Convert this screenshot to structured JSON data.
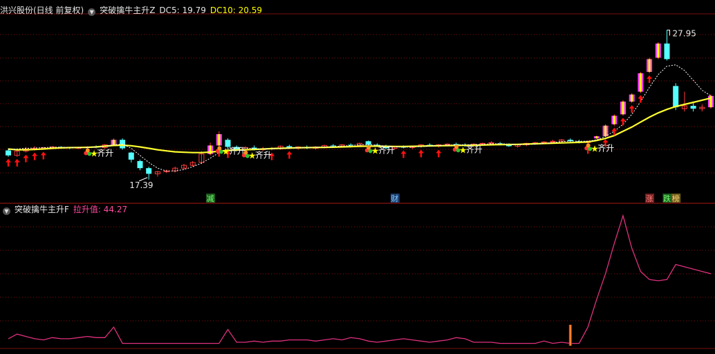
{
  "upper_panel": {
    "stock": "洪兴股份(日线 前复权)",
    "indicator": "突破擒牛主升Z",
    "dc5_label": "DC5: 19.79",
    "dc10_label": "DC10: 20.59",
    "high_label": "27.95",
    "low_label": "17.39",
    "signal_label": "齐升",
    "badges": {
      "jian": "减",
      "cai": "财",
      "zhang": "涨",
      "die": "跌",
      "bang": "榜"
    }
  },
  "lower_panel": {
    "indicator": "突破擒牛主升F",
    "value_label": "拉升值: 44.27"
  },
  "colors": {
    "up": "#ff3a3a",
    "down": "#54ffff",
    "magenta": "#ff3cff",
    "yellow": "#ffff00",
    "ma_line": "#ffff30",
    "grid": "#8a0f0f",
    "line_f": "#e0307f"
  },
  "chart_data": [
    {
      "type": "candlestick",
      "title": "洪兴股份(日线 前复权)",
      "ylim": [
        16.5,
        29
      ],
      "candles": [
        [
          19.45,
          19.6,
          19.0,
          19.1
        ],
        [
          19.1,
          19.55,
          19.0,
          19.4
        ],
        [
          19.4,
          19.7,
          19.3,
          19.55
        ],
        [
          19.55,
          19.75,
          19.45,
          19.6
        ],
        [
          19.6,
          19.7,
          19.5,
          19.65
        ],
        [
          19.65,
          19.75,
          19.55,
          19.7
        ],
        [
          19.7,
          19.75,
          19.6,
          19.65
        ],
        [
          19.65,
          19.7,
          19.55,
          19.6
        ],
        [
          19.6,
          19.7,
          19.55,
          19.65
        ],
        [
          19.65,
          19.75,
          19.55,
          19.7
        ],
        [
          19.7,
          19.8,
          19.6,
          19.65
        ],
        [
          19.65,
          19.9,
          19.55,
          19.85
        ],
        [
          19.8,
          20.3,
          19.75,
          20.2
        ],
        [
          20.2,
          20.3,
          19.5,
          19.6
        ],
        [
          19.3,
          19.35,
          18.6,
          18.8
        ],
        [
          18.7,
          18.8,
          18.05,
          18.2
        ],
        [
          18.2,
          18.3,
          17.39,
          17.8
        ],
        [
          17.8,
          18.0,
          17.6,
          17.95
        ],
        [
          17.95,
          18.1,
          17.85,
          18.0
        ],
        [
          18.0,
          18.3,
          17.9,
          18.2
        ],
        [
          18.2,
          18.5,
          18.1,
          18.4
        ],
        [
          18.4,
          18.7,
          18.3,
          18.6
        ],
        [
          18.6,
          19.4,
          18.5,
          19.2
        ],
        [
          19.2,
          20.0,
          19.1,
          19.8
        ],
        [
          19.8,
          20.8,
          19.7,
          20.6
        ],
        [
          20.2,
          20.3,
          19.6,
          19.7
        ],
        [
          19.7,
          19.8,
          19.4,
          19.5
        ],
        [
          19.5,
          19.75,
          19.4,
          19.65
        ],
        [
          19.65,
          19.8,
          19.45,
          19.5
        ],
        [
          19.5,
          19.7,
          19.4,
          19.55
        ],
        [
          19.55,
          19.7,
          19.45,
          19.6
        ],
        [
          19.6,
          19.8,
          19.5,
          19.75
        ],
        [
          19.75,
          19.85,
          19.55,
          19.6
        ],
        [
          19.6,
          19.75,
          19.5,
          19.7
        ],
        [
          19.7,
          19.8,
          19.55,
          19.6
        ],
        [
          19.6,
          19.75,
          19.5,
          19.7
        ],
        [
          19.7,
          19.85,
          19.6,
          19.8
        ],
        [
          19.8,
          19.9,
          19.7,
          19.75
        ],
        [
          19.75,
          19.9,
          19.65,
          19.85
        ],
        [
          19.85,
          19.95,
          19.75,
          19.8
        ],
        [
          19.8,
          20.0,
          19.7,
          19.95
        ],
        [
          20.1,
          20.15,
          19.75,
          19.85
        ],
        [
          19.85,
          19.95,
          19.7,
          19.8
        ],
        [
          19.75,
          19.85,
          19.55,
          19.6
        ],
        [
          19.6,
          19.75,
          19.5,
          19.7
        ],
        [
          19.7,
          19.8,
          19.6,
          19.65
        ],
        [
          19.65,
          19.8,
          19.55,
          19.75
        ],
        [
          19.75,
          19.9,
          19.65,
          19.85
        ],
        [
          19.85,
          19.95,
          19.75,
          19.8
        ],
        [
          19.75,
          19.9,
          19.65,
          19.85
        ],
        [
          19.85,
          19.95,
          19.75,
          19.9
        ],
        [
          19.9,
          20.0,
          19.8,
          19.85
        ],
        [
          19.85,
          19.95,
          19.7,
          19.8
        ],
        [
          19.8,
          19.95,
          19.7,
          19.9
        ],
        [
          19.9,
          20.0,
          19.8,
          19.95
        ],
        [
          19.95,
          20.1,
          19.85,
          20.0
        ],
        [
          19.95,
          20.05,
          19.8,
          19.9
        ],
        [
          19.85,
          19.95,
          19.7,
          19.75
        ],
        [
          19.75,
          19.9,
          19.65,
          19.85
        ],
        [
          19.85,
          20.0,
          19.75,
          19.95
        ],
        [
          19.95,
          20.05,
          19.85,
          20.0
        ],
        [
          20.0,
          20.1,
          19.9,
          20.05
        ],
        [
          20.05,
          20.2,
          19.95,
          20.1
        ],
        [
          20.1,
          20.25,
          20.0,
          20.2
        ],
        [
          20.2,
          20.3,
          20.05,
          20.1
        ],
        [
          20.1,
          20.2,
          19.95,
          20.0
        ],
        [
          20.0,
          20.15,
          19.9,
          20.1
        ],
        [
          20.3,
          20.5,
          20.25,
          20.45
        ],
        [
          20.45,
          21.3,
          20.4,
          21.2
        ],
        [
          21.3,
          22.0,
          21.2,
          21.9
        ],
        [
          22.0,
          23.0,
          21.9,
          22.9
        ],
        [
          22.9,
          23.5,
          22.8,
          23.4
        ],
        [
          23.6,
          25.0,
          23.5,
          24.9
        ],
        [
          25.0,
          26.0,
          24.9,
          25.9
        ],
        [
          26.0,
          27.1,
          25.9,
          27.0
        ],
        [
          27.0,
          27.95,
          25.8,
          25.9
        ],
        [
          24.0,
          24.2,
          22.3,
          22.5
        ],
        [
          22.4,
          23.6,
          22.2,
          22.6
        ],
        [
          22.6,
          22.8,
          22.2,
          22.4
        ],
        [
          22.4,
          22.7,
          22.2,
          22.5
        ],
        [
          22.5,
          23.4,
          22.4,
          23.3
        ]
      ],
      "dc_ma": [
        19.55,
        19.5,
        19.5,
        19.52,
        19.55,
        19.6,
        19.63,
        19.65,
        19.66,
        19.67,
        19.7,
        19.75,
        19.8,
        19.82,
        19.78,
        19.7,
        19.6,
        19.5,
        19.42,
        19.35,
        19.32,
        19.3,
        19.3,
        19.33,
        19.4,
        19.45,
        19.48,
        19.5,
        19.52,
        19.55,
        19.58,
        19.6,
        19.62,
        19.64,
        19.65,
        19.66,
        19.67,
        19.68,
        19.7,
        19.72,
        19.74,
        19.75,
        19.75,
        19.74,
        19.73,
        19.73,
        19.74,
        19.75,
        19.77,
        19.78,
        19.79,
        19.8,
        19.81,
        19.82,
        19.83,
        19.85,
        19.86,
        19.87,
        19.88,
        19.9,
        19.92,
        19.94,
        19.96,
        19.98,
        20.0,
        20.02,
        20.05,
        20.15,
        20.3,
        20.5,
        20.8,
        21.1,
        21.45,
        21.8,
        22.1,
        22.35,
        22.55,
        22.7,
        22.85,
        23.0,
        23.15
      ],
      "dc_dash": [
        19.5,
        19.55,
        19.6,
        19.62,
        19.65,
        19.68,
        19.68,
        19.66,
        19.65,
        19.66,
        19.68,
        19.72,
        19.85,
        19.9,
        19.6,
        19.1,
        18.6,
        18.2,
        18.0,
        18.0,
        18.1,
        18.3,
        18.55,
        18.9,
        19.3,
        19.55,
        19.65,
        19.62,
        19.58,
        19.55,
        19.56,
        19.6,
        19.62,
        19.64,
        19.65,
        19.67,
        19.7,
        19.72,
        19.76,
        19.8,
        19.85,
        19.86,
        19.82,
        19.75,
        19.7,
        19.68,
        19.7,
        19.72,
        19.76,
        19.8,
        19.83,
        19.85,
        19.85,
        19.86,
        19.88,
        19.92,
        19.93,
        19.9,
        19.86,
        19.87,
        19.9,
        19.95,
        20.0,
        20.08,
        20.12,
        20.1,
        20.1,
        20.2,
        20.45,
        20.8,
        21.3,
        22.0,
        22.9,
        23.9,
        24.8,
        25.4,
        25.5,
        25.1,
        24.4,
        23.7,
        23.3
      ],
      "red_arrows": [
        0,
        1,
        2,
        3,
        4,
        24,
        25,
        30,
        32,
        45,
        47,
        49,
        66,
        68,
        69,
        70,
        71,
        72,
        73
      ],
      "qisheng_signals": [
        9,
        24,
        27,
        41,
        51,
        66
      ],
      "badge_positions": {
        "jian": 23,
        "cai": 44,
        "zhang": 73,
        "die": 75,
        "bang": 76
      }
    },
    {
      "type": "line",
      "title": "突破擒牛主升F",
      "ylim": [
        0,
        56
      ],
      "values": [
        3,
        5,
        4,
        3,
        2.5,
        3.5,
        3,
        3,
        3.5,
        4,
        3.5,
        3.5,
        8,
        1,
        1,
        1,
        1,
        1,
        1,
        1,
        1,
        1,
        1,
        1,
        1,
        7,
        1.5,
        1.5,
        2,
        1.5,
        2,
        2,
        2.5,
        2.5,
        2.5,
        2,
        2.5,
        3,
        2.5,
        3.5,
        3,
        2,
        1.5,
        2,
        2.5,
        3,
        2.5,
        2,
        1.5,
        2,
        2.5,
        3.5,
        3,
        1.5,
        1.5,
        1.5,
        1,
        1,
        1,
        1,
        1,
        2,
        1,
        1.5,
        1,
        1,
        8,
        20,
        31,
        44,
        56,
        42,
        32,
        28.5,
        28,
        28.5,
        35,
        34,
        33,
        32,
        31
      ],
      "marker_index": 64,
      "marker_height": 9
    }
  ]
}
